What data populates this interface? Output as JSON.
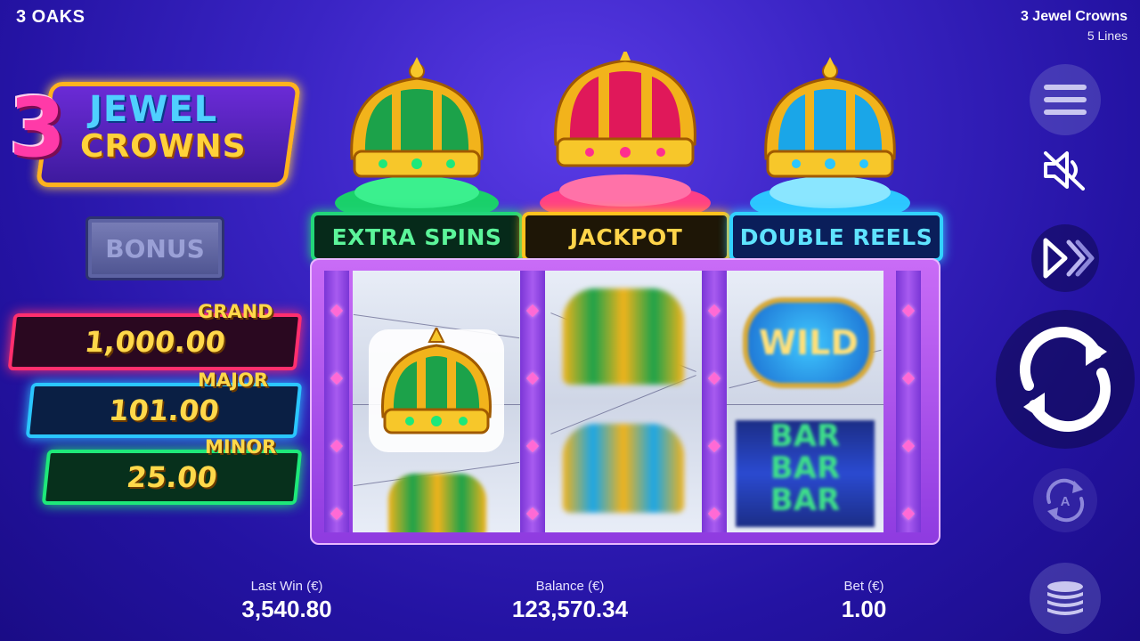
{
  "header": {
    "brand": "3 OAKS",
    "game_title": "3 Jewel Crowns",
    "lines": "5 Lines"
  },
  "logo": {
    "number": "3",
    "line1": "JEWEL",
    "line2": "CROWNS"
  },
  "bonus_button": {
    "label": "BONUS"
  },
  "jackpots": {
    "grand": {
      "label": "GRAND",
      "value": "1,000.00"
    },
    "major": {
      "label": "MAJOR",
      "value": "101.00"
    },
    "minor": {
      "label": "MINOR",
      "value": "25.00"
    }
  },
  "features": {
    "extra_spins": "EXTRA SPINS",
    "jackpot": "JACKPOT",
    "double_reels": "DOUBLE REELS"
  },
  "reels": {
    "wild_symbol": "WILD",
    "bar_symbol": "BAR"
  },
  "controls": {
    "menu_icon": "hamburger-menu-icon",
    "sound_icon": "sound-muted-icon",
    "turbo_icon": "fast-forward-icon",
    "spin_icon": "spin-arrows-icon",
    "autoplay_icon": "autoplay-icon",
    "autoplay_letter": "A",
    "bet_icon": "coin-stack-icon"
  },
  "footer": {
    "last_win_label": "Last Win (€)",
    "last_win_value": "3,540.80",
    "balance_label": "Balance (€)",
    "balance_value": "123,570.34",
    "bet_label": "Bet (€)",
    "bet_value": "1.00"
  },
  "colors": {
    "green": "#22d67a",
    "gold": "#ffc21e",
    "blue": "#32d2ff",
    "pink": "#ff2f6e"
  }
}
